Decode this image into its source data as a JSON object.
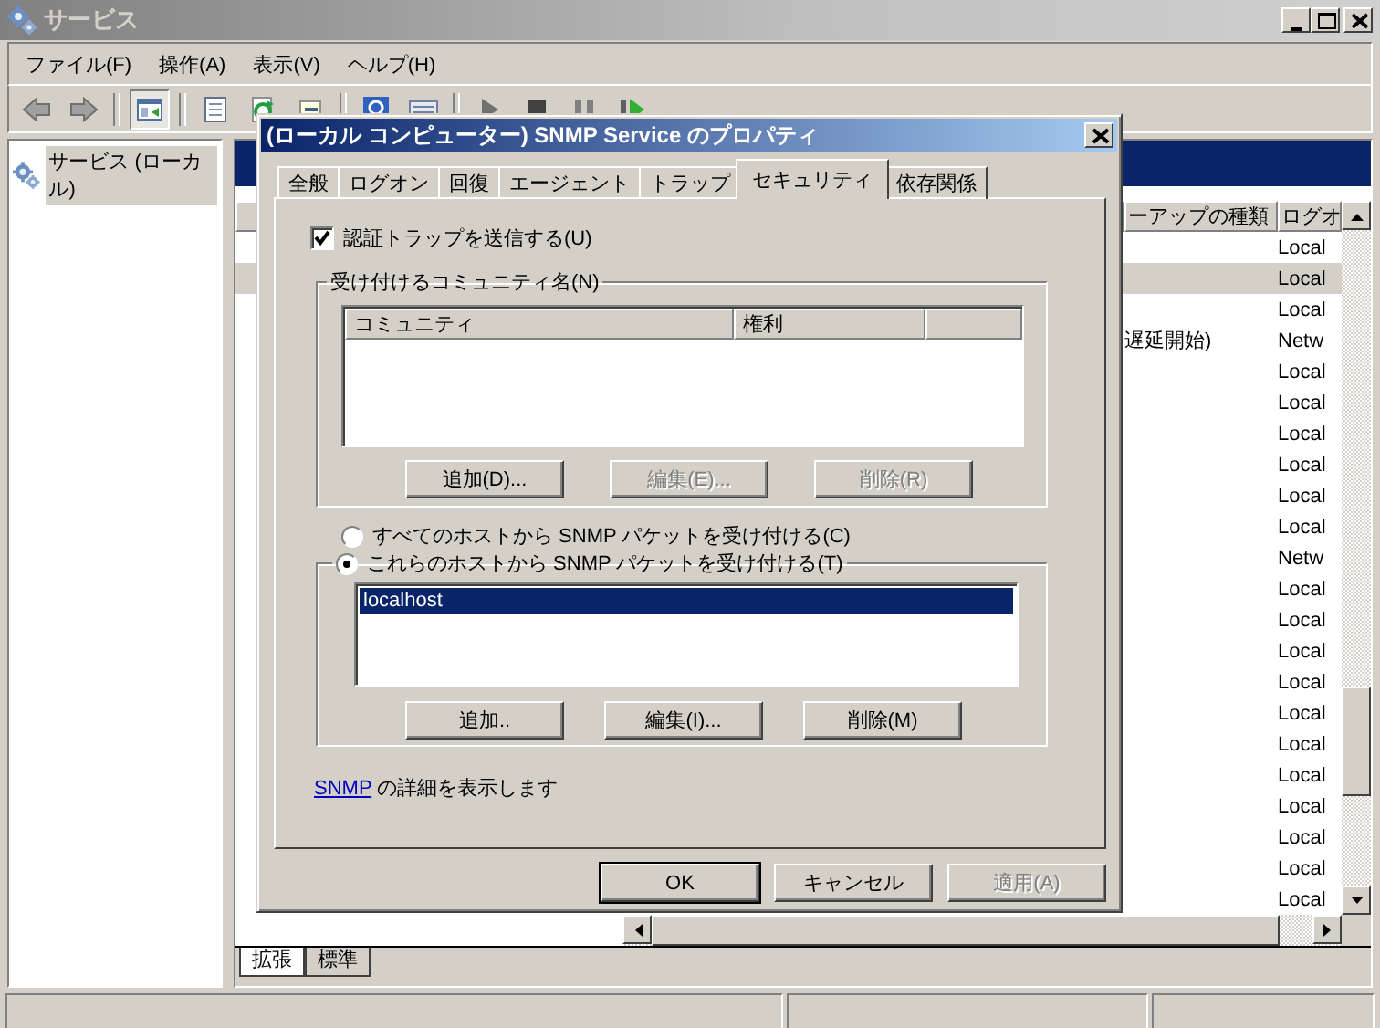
{
  "window": {
    "title": "サービス"
  },
  "menu": [
    "ファイル(F)",
    "操作(A)",
    "表示(V)",
    "ヘルプ(H)"
  ],
  "toolbar": [
    [
      {
        "kind": "back",
        "pressed": false
      },
      {
        "kind": "forward",
        "pressed": false
      }
    ],
    [
      {
        "kind": "tree",
        "pressed": true
      }
    ],
    [
      {
        "kind": "properties",
        "pressed": false
      },
      {
        "kind": "refresh",
        "pressed": false
      },
      {
        "kind": "export",
        "pressed": false
      }
    ],
    [
      {
        "kind": "help",
        "pressed": false
      },
      {
        "kind": "console",
        "pressed": false
      }
    ],
    [
      {
        "kind": "play",
        "pressed": false
      },
      {
        "kind": "stop",
        "pressed": false
      },
      {
        "kind": "pause",
        "pressed": false
      },
      {
        "kind": "restart",
        "pressed": false
      }
    ]
  ],
  "tree": [
    {
      "label": "サービス (ローカル)",
      "selected": true
    }
  ],
  "services": {
    "columns": [
      "ーアップの種類",
      "ログオ"
    ],
    "rows": [
      {
        "logon": "Local",
        "selected": false
      },
      {
        "logon": "Local",
        "selected": true
      },
      {
        "logon": "Local",
        "selected": false
      },
      {
        "startup": "遅延開始)",
        "logon": "Netw",
        "selected": false
      },
      {
        "logon": "Local",
        "selected": false
      },
      {
        "logon": "Local",
        "selected": false
      },
      {
        "logon": "Local",
        "selected": false
      },
      {
        "logon": "Local",
        "selected": false
      },
      {
        "logon": "Local",
        "selected": false
      },
      {
        "logon": "Local",
        "selected": false
      },
      {
        "logon": "Netw",
        "selected": false
      },
      {
        "logon": "Local",
        "selected": false
      },
      {
        "logon": "Local",
        "selected": false
      },
      {
        "logon": "Local",
        "selected": false
      },
      {
        "logon": "Local",
        "selected": false
      },
      {
        "logon": "Local",
        "selected": false
      },
      {
        "logon": "Local",
        "selected": false
      },
      {
        "logon": "Local",
        "selected": false
      },
      {
        "logon": "Local",
        "selected": false
      },
      {
        "logon": "Local",
        "selected": false
      },
      {
        "logon": "Local",
        "selected": false
      },
      {
        "logon": "Local",
        "selected": false
      }
    ]
  },
  "view_tabs": [
    {
      "label": "拡張",
      "selected": true
    },
    {
      "label": "標準",
      "selected": false
    }
  ],
  "dialog": {
    "title": "(ローカル コンピューター) SNMP Service のプロパティ",
    "tabs": [
      {
        "label": "全般",
        "selected": false
      },
      {
        "label": "ログオン",
        "selected": false
      },
      {
        "label": "回復",
        "selected": false
      },
      {
        "label": "エージェント",
        "selected": false
      },
      {
        "label": "トラップ",
        "selected": false
      },
      {
        "label": "セキュリティ",
        "selected": true
      },
      {
        "label": "依存関係",
        "selected": false
      }
    ],
    "send_auth_trap": {
      "label": "認証トラップを送信する(U)",
      "checked": true
    },
    "communities": {
      "legend": "受け付けるコミュニティ名(N)",
      "columns": [
        "コミュニティ",
        "権利"
      ],
      "buttons": [
        {
          "label": "追加(D)...",
          "disabled": false
        },
        {
          "label": "編集(E)...",
          "disabled": true
        },
        {
          "label": "削除(R)",
          "disabled": true
        }
      ]
    },
    "accept_options": [
      {
        "label": "すべてのホストから SNMP パケットを受け付ける(C)",
        "selected": false
      },
      {
        "label": "これらのホストから SNMP パケットを受け付ける(T)",
        "selected": true
      }
    ],
    "hosts": {
      "items": [
        {
          "label": "localhost",
          "selected": true
        }
      ],
      "buttons": [
        {
          "label": "追加..",
          "disabled": false
        },
        {
          "label": "編集(I)...",
          "disabled": false
        },
        {
          "label": "削除(M)",
          "disabled": false
        }
      ]
    },
    "info": {
      "link": "SNMP",
      "text": "の詳細を表示します"
    },
    "buttons": [
      {
        "label": "OK",
        "default": true,
        "disabled": false
      },
      {
        "label": "キャンセル",
        "default": false,
        "disabled": false
      },
      {
        "label": "適用(A)",
        "default": false,
        "disabled": true
      }
    ]
  }
}
